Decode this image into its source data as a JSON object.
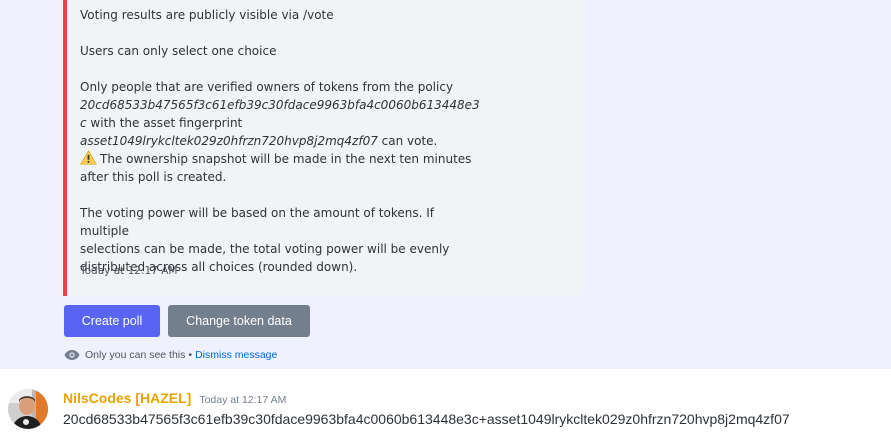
{
  "embed": {
    "line_results": "Voting results are publicly visible via /vote",
    "line_choice": "Users can only select one choice",
    "ownership_intro": "Only people that are verified owners of tokens from the policy",
    "policy_part1": "20cd68533b47565f3c61efb39c30fdace9963bfa4c0060b613448e3",
    "policy_part2": "c",
    "fingerprint_intro": " with the asset fingerprint",
    "fingerprint": "asset1049lrykcltek029z0hfrzn720hvp8j2mq4zf07",
    "can_vote": " can vote.",
    "snapshot_line1": "The ownership snapshot will be made in the next ten minutes",
    "snapshot_line2": "after this poll is created.",
    "power_line1": "The voting power will be based on the amount of tokens. If multiple",
    "power_line2": "selections can be made, the total voting power will be evenly",
    "power_line3": "distributed across all choices (rounded down).",
    "footer_time": "Today at 12:17 AM",
    "accent_color": "#ed4245",
    "warning_icon": "warning-icon"
  },
  "buttons": {
    "create_poll": "Create poll",
    "change_token": "Change token data"
  },
  "ephemeral": {
    "eye_icon": "eye-icon",
    "only_you": "Only you can see this",
    "separator": "•",
    "dismiss": "Dismiss message"
  },
  "message": {
    "author": "NilsCodes [HAZEL]",
    "author_color": "#e6a400",
    "time": "Today at 12:17 AM",
    "content": "20cd68533b47565f3c61efb39c30fdace9963bfa4c0060b613448e3c+asset1049lrykcltek029z0hfrzn720hvp8j2mq4zf07"
  }
}
